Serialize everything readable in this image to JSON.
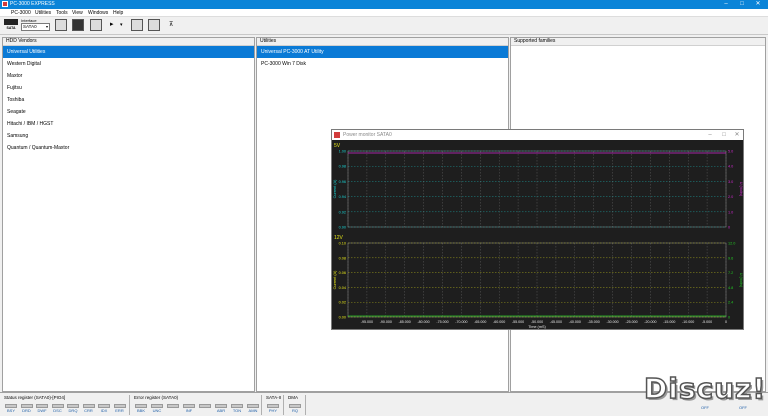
{
  "window": {
    "title": "PC-3000 EXPRESS"
  },
  "menu": [
    "PC-3000",
    "Utilities",
    "Tools",
    "View",
    "Windows",
    "Help"
  ],
  "toolbar": {
    "sata_label": "SATA",
    "interface_caption": "Interface",
    "interface_value": "SATA0"
  },
  "panes": {
    "vendors": {
      "header": "HDD Vendors",
      "items": [
        "Universal Utilities",
        "Western Digital",
        "Maxtor",
        "Fujitsu",
        "Toshiba",
        "Seagate",
        "Hitachi / IBM / HGST",
        "Samsung",
        "Quantum / Quantum-Maxtor"
      ]
    },
    "utilities": {
      "header": "Utilities",
      "items": [
        "Universal PC-3000 AT Utility",
        "PC-3000 Win 7 Disk"
      ]
    },
    "families": {
      "header": "Supported families"
    }
  },
  "power_monitor": {
    "title": "Power monitor SATA0",
    "x_ticks": [
      "-95.000",
      "-90.000",
      "-85.000",
      "-80.000",
      "-75.000",
      "-70.000",
      "-65.000",
      "-60.000",
      "-55.000",
      "-50.000",
      "-45.000",
      "-40.000",
      "-35.000",
      "-30.000",
      "-25.000",
      "-20.000",
      "-15.000",
      "-10.000",
      "-5.000",
      "0"
    ],
    "x_label": "Time (mS)",
    "colors": {
      "cyan": "#19d3d3",
      "magenta": "#d22ad2",
      "yellow": "#e6e619",
      "green": "#23c823",
      "bg": "#1e1e1e",
      "grid": "#8a8a8a"
    }
  },
  "chart_data": [
    {
      "type": "line",
      "title": "5V",
      "ylabel": "Current (A)",
      "y2label": "U (Volts)",
      "ylim": [
        0.9,
        1.0
      ],
      "y_ticks": [
        "0.90",
        "0.92",
        "0.94",
        "0.96",
        "0.98",
        "1.00"
      ],
      "y2_ticks": [
        "0",
        "1.0",
        "2.0",
        "3.0",
        "4.0",
        "5.0"
      ],
      "xlim": [
        -100,
        0
      ],
      "grid": true,
      "series": []
    },
    {
      "type": "line",
      "title": "12V",
      "ylabel": "Current (A)",
      "y2label": "U (Volts)",
      "ylim": [
        0.0,
        0.1
      ],
      "y_ticks": [
        "0.00",
        "0.02",
        "0.04",
        "0.06",
        "0.08",
        "0.10"
      ],
      "y2_ticks": [
        "0",
        "2.4",
        "4.8",
        "7.2",
        "9.6",
        "12.0"
      ],
      "xlim": [
        -100,
        0
      ],
      "grid": true,
      "series": []
    }
  ],
  "status": {
    "status_register": {
      "title": "Status register (SATA0)-[PIO4]",
      "flags": [
        "BSY",
        "DRD",
        "DWF",
        "DSC",
        "DRQ",
        "CRR",
        "IDX",
        "ERR"
      ]
    },
    "error_register": {
      "title": "Error register (SATA0)",
      "flags": [
        "BBK",
        "UNC",
        "",
        "INF",
        "",
        "ABR",
        "TON",
        "AMN"
      ]
    },
    "sata": {
      "title": "SATA-II",
      "flags": [
        "PHY"
      ]
    },
    "dma": {
      "title": "DMA",
      "flags": [
        "RQ"
      ]
    },
    "power": {
      "values": [
        "OFF",
        "OFF"
      ]
    }
  },
  "watermark": "Discuz!"
}
